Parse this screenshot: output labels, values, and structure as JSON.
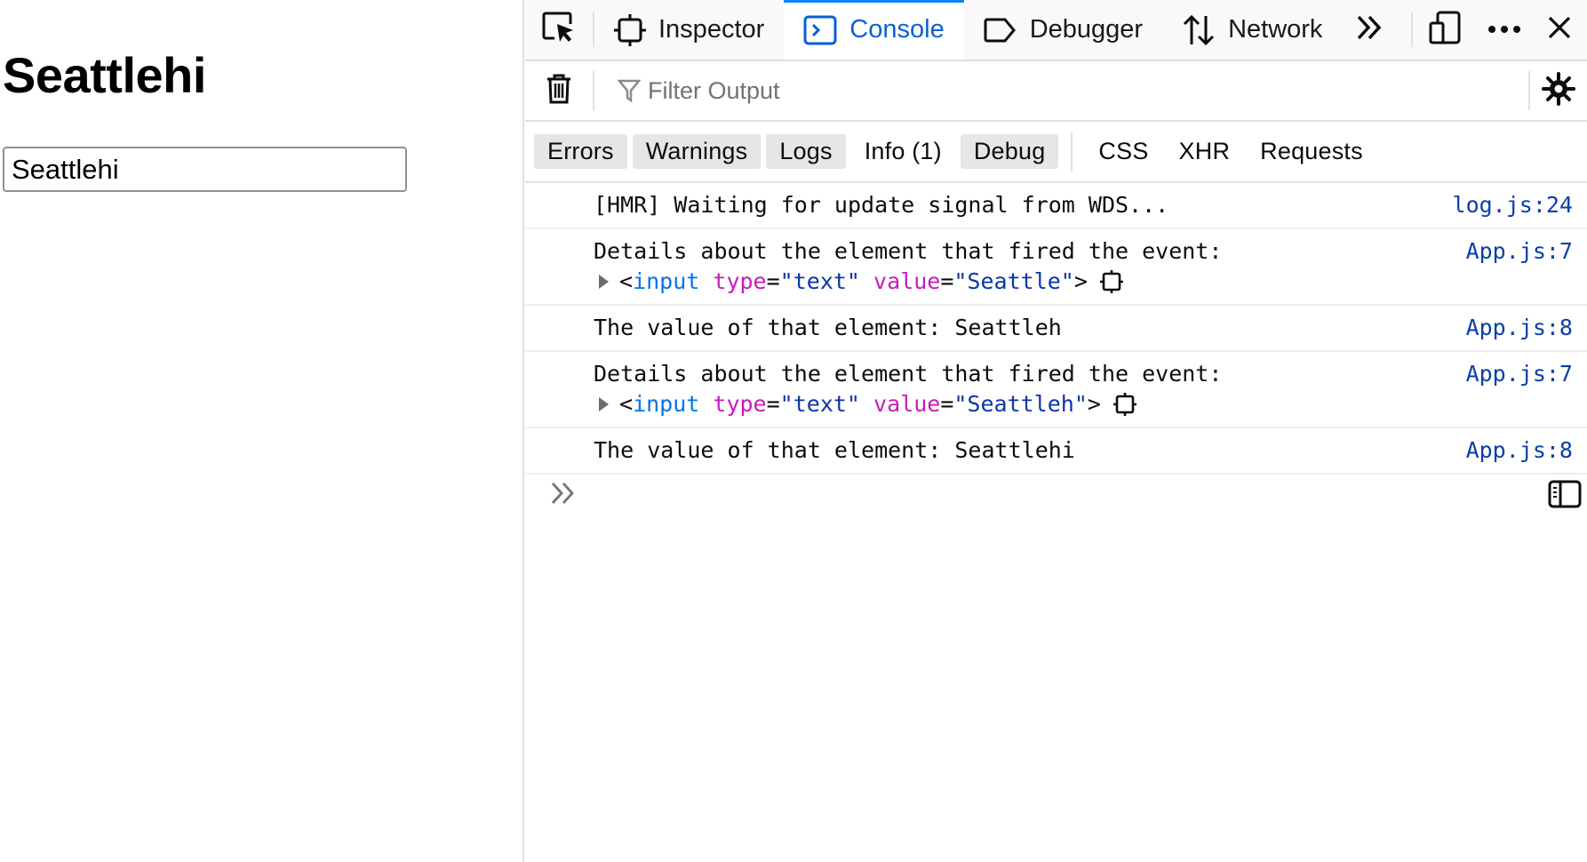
{
  "page": {
    "heading": "Seattlehi",
    "input_value": "Seattlehi"
  },
  "toolbox": {
    "tabs": [
      {
        "label": "Inspector",
        "icon": "inspector-icon",
        "active": false
      },
      {
        "label": "Console",
        "icon": "console-icon",
        "active": true
      },
      {
        "label": "Debugger",
        "icon": "debugger-icon",
        "active": false
      },
      {
        "label": "Network",
        "icon": "network-icon",
        "active": false
      }
    ],
    "accent_color": "#0a84ff"
  },
  "filter": {
    "placeholder": "Filter Output"
  },
  "levels": {
    "errors": "Errors",
    "warnings": "Warnings",
    "logs": "Logs",
    "info": "Info (1)",
    "debug": "Debug",
    "css": "CSS",
    "xhr": "XHR",
    "requests": "Requests"
  },
  "messages": [
    {
      "text": "[HMR] Waiting for update signal from WDS...",
      "location": "log.js:24"
    },
    {
      "text": "Details about the element that fired the event:",
      "location": "App.js:7",
      "element": {
        "tag": "input",
        "type_attr": "type",
        "type_val": "\"text\"",
        "value_attr": "value",
        "value_val": "\"Seattle\""
      }
    },
    {
      "text": "The value of that element: Seattleh",
      "location": "App.js:8"
    },
    {
      "text": "Details about the element that fired the event:",
      "location": "App.js:7",
      "element": {
        "tag": "input",
        "type_attr": "type",
        "type_val": "\"text\"",
        "value_attr": "value",
        "value_val": "\"Seattleh\""
      }
    },
    {
      "text": "The value of that element: Seattlehi",
      "location": "App.js:8"
    }
  ]
}
